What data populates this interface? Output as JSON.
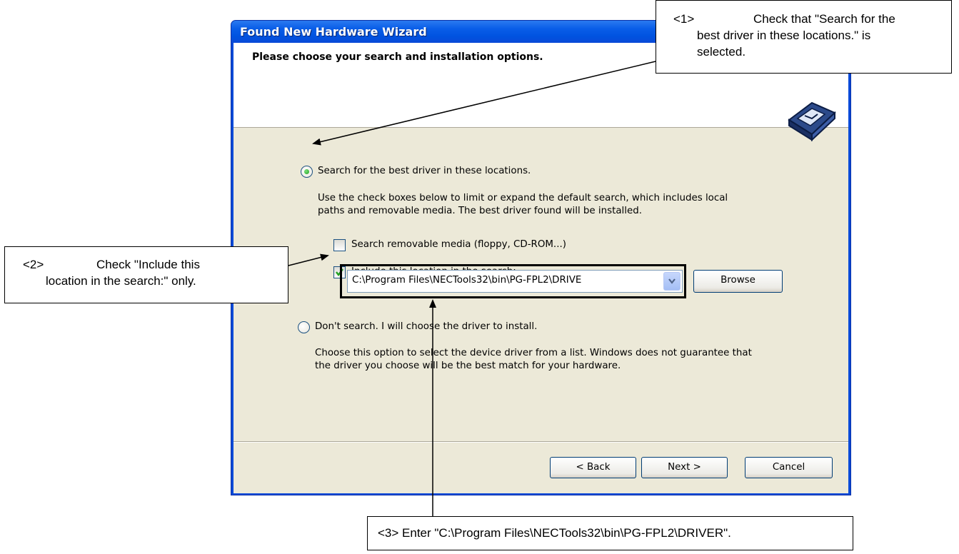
{
  "window": {
    "title": "Found New Hardware Wizard",
    "header_title": "Please choose your search and installation options."
  },
  "options": {
    "search_radio_label": "Search for the best driver in these locations.",
    "search_radio_selected": true,
    "search_description_line1": "Use the check boxes below to limit or expand the default search, which includes local",
    "search_description_line2": "paths and removable media. The best driver found will be installed.",
    "removable_media_label": "Search removable media (floppy, CD-ROM...)",
    "removable_media_checked": false,
    "include_location_label": "Include this location in the search:",
    "include_location_checked": true,
    "location_value": "C:\\Program Files\\NECTools32\\bin\\PG-FPL2\\DRIVE",
    "browse_label": "Browse",
    "dont_search_radio_label": "Don't search. I will choose the driver to install.",
    "dont_search_description_line1": "Choose this option to select the device driver from a list.  Windows does not guarantee that",
    "dont_search_description_line2": "the driver you choose will be the best match for your hardware."
  },
  "footer": {
    "back_label": "< Back",
    "next_label": "Next >",
    "cancel_label": "Cancel"
  },
  "callouts": {
    "c1": {
      "number": "<1>",
      "line1": "Check that \"Search for the",
      "line2": "best driver in these locations.\" is",
      "line3": "selected."
    },
    "c2": {
      "number": "<2>",
      "line1": "Check \"Include this",
      "line2": "location in the search:\" only."
    },
    "c3": {
      "text": "<3>  Enter \"C:\\Program Files\\NECTools32\\bin\\PG-FPL2\\DRIVER\"."
    }
  },
  "colors": {
    "titlebar": "#0a5ee8",
    "dialog_bg": "#ece9d8",
    "radio_dot": "#21a121",
    "checkmark": "#21a121"
  },
  "icons": [
    "hardware-wizard-icon",
    "radio-selected-icon",
    "checkbox-checked-icon",
    "dropdown-arrow-icon",
    "arrow-icon"
  ]
}
